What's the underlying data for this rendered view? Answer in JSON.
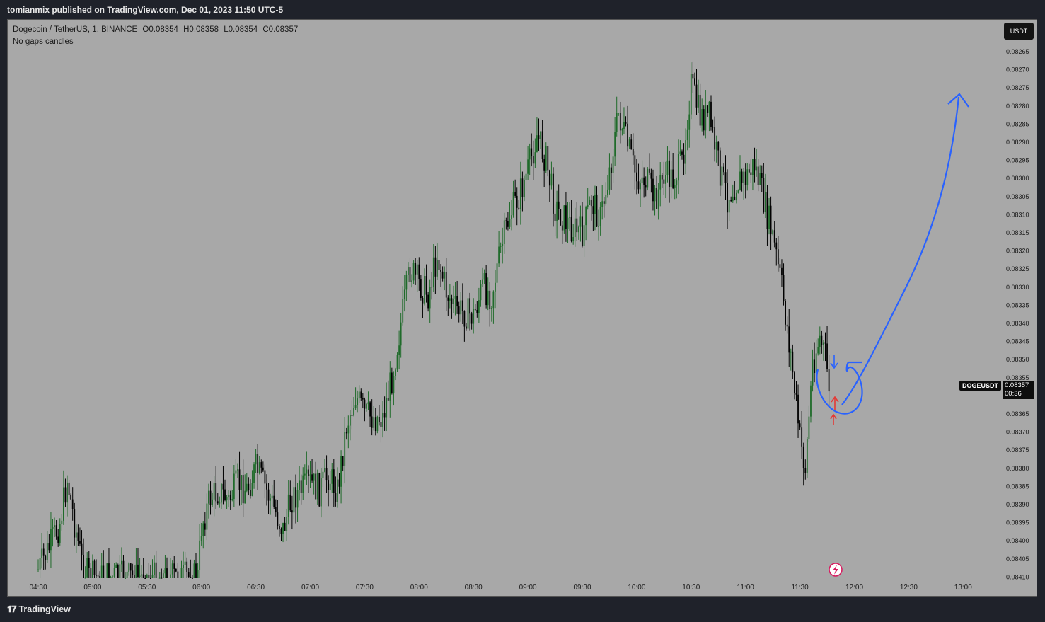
{
  "header": {
    "publish_text": "tomianmix published on TradingView.com, Dec 01, 2023 11:50 UTC-5"
  },
  "legend": {
    "symbol_line": "Dogecoin / TetherUS, 1, BINANCE",
    "open": "O0.08354",
    "high": "H0.08358",
    "low": "L0.08354",
    "close": "C0.08357",
    "subtitle": "No gaps candles"
  },
  "toolbar": {
    "currency_label": "USDT"
  },
  "price_tag": {
    "symbol": "DOGEUSDT",
    "price": "0.08357",
    "countdown": "00:36"
  },
  "footer": {
    "brand": "TradingView",
    "logo_icon": "tradingview-logo-icon"
  },
  "colors": {
    "background": "#a8a8a8",
    "candle_up": "#1f6b2a",
    "candle_down": "#000000",
    "annotation_blue": "#2962ff",
    "annotation_red": "#e53935"
  },
  "chart_data": {
    "type": "candlestick",
    "symbol": "DOGEUSDT",
    "interval": "1",
    "y_ticks": [
      "0.08265",
      "0.08270",
      "0.08275",
      "0.08280",
      "0.08285",
      "0.08290",
      "0.08295",
      "0.08300",
      "0.08305",
      "0.08310",
      "0.08315",
      "0.08320",
      "0.08325",
      "0.08330",
      "0.08335",
      "0.08340",
      "0.08345",
      "0.08350",
      "0.08355",
      "0.08360",
      "0.08365",
      "0.08370",
      "0.08375",
      "0.08380",
      "0.08385",
      "0.08390",
      "0.08395",
      "0.08400",
      "0.08405",
      "0.08410"
    ],
    "x_ticks": [
      "04:30",
      "05:00",
      "05:30",
      "06:00",
      "06:30",
      "07:00",
      "07:30",
      "08:00",
      "08:30",
      "09:00",
      "09:30",
      "10:00",
      "10:30",
      "11:00",
      "11:30",
      "12:00",
      "12:30",
      "13:00"
    ],
    "ylim": [
      0.0841,
      0.08263
    ],
    "last_price": 0.08357,
    "close_path": [
      [
        "04:30",
        0.08408
      ],
      [
        "04:36",
        0.08402
      ],
      [
        "04:42",
        0.08395
      ],
      [
        "04:46",
        0.08383
      ],
      [
        "04:50",
        0.08395
      ],
      [
        "04:54",
        0.08406
      ],
      [
        "04:58",
        0.0841
      ],
      [
        "05:30",
        0.0841
      ],
      [
        "05:58",
        0.0841
      ],
      [
        "06:00",
        0.08396
      ],
      [
        "06:05",
        0.08388
      ],
      [
        "06:10",
        0.08386
      ],
      [
        "06:15",
        0.08389
      ],
      [
        "06:20",
        0.08384
      ],
      [
        "06:25",
        0.08386
      ],
      [
        "06:30",
        0.0838
      ],
      [
        "06:35",
        0.08385
      ],
      [
        "06:40",
        0.08391
      ],
      [
        "06:45",
        0.08397
      ],
      [
        "06:50",
        0.08388
      ],
      [
        "06:55",
        0.08386
      ],
      [
        "07:00",
        0.08384
      ],
      [
        "07:05",
        0.08386
      ],
      [
        "07:10",
        0.08382
      ],
      [
        "07:15",
        0.08386
      ],
      [
        "07:20",
        0.08368
      ],
      [
        "07:25",
        0.0836
      ],
      [
        "07:30",
        0.08365
      ],
      [
        "07:35",
        0.08366
      ],
      [
        "07:40",
        0.08366
      ],
      [
        "07:45",
        0.08355
      ],
      [
        "07:50",
        0.0834
      ],
      [
        "07:55",
        0.08325
      ],
      [
        "08:00",
        0.08329
      ],
      [
        "08:05",
        0.08332
      ],
      [
        "08:10",
        0.08321
      ],
      [
        "08:15",
        0.08331
      ],
      [
        "08:20",
        0.08336
      ],
      [
        "08:25",
        0.08337
      ],
      [
        "08:30",
        0.08338
      ],
      [
        "08:35",
        0.0833
      ],
      [
        "08:40",
        0.08332
      ],
      [
        "08:45",
        0.0832
      ],
      [
        "08:50",
        0.0831
      ],
      [
        "08:55",
        0.08305
      ],
      [
        "09:00",
        0.08298
      ],
      [
        "09:05",
        0.08288
      ],
      [
        "09:10",
        0.08295
      ],
      [
        "09:15",
        0.08308
      ],
      [
        "09:20",
        0.08311
      ],
      [
        "09:25",
        0.08314
      ],
      [
        "09:30",
        0.08315
      ],
      [
        "09:35",
        0.08306
      ],
      [
        "09:40",
        0.08311
      ],
      [
        "09:45",
        0.08298
      ],
      [
        "09:50",
        0.08282
      ],
      [
        "09:55",
        0.08291
      ],
      [
        "10:00",
        0.083
      ],
      [
        "10:05",
        0.083
      ],
      [
        "10:10",
        0.08306
      ],
      [
        "10:15",
        0.08299
      ],
      [
        "10:20",
        0.083
      ],
      [
        "10:25",
        0.08296
      ],
      [
        "10:30",
        0.08274
      ],
      [
        "10:35",
        0.08283
      ],
      [
        "10:40",
        0.08283
      ],
      [
        "10:45",
        0.08296
      ],
      [
        "10:50",
        0.08305
      ],
      [
        "10:55",
        0.08301
      ],
      [
        "11:00",
        0.083
      ],
      [
        "11:05",
        0.08296
      ],
      [
        "11:10",
        0.08306
      ],
      [
        "11:15",
        0.08316
      ],
      [
        "11:20",
        0.0833
      ],
      [
        "11:25",
        0.08349
      ],
      [
        "11:30",
        0.08372
      ],
      [
        "11:33",
        0.0838
      ],
      [
        "11:37",
        0.08351
      ],
      [
        "11:41",
        0.08344
      ],
      [
        "11:44",
        0.08349
      ],
      [
        "11:46",
        0.08357
      ]
    ]
  }
}
